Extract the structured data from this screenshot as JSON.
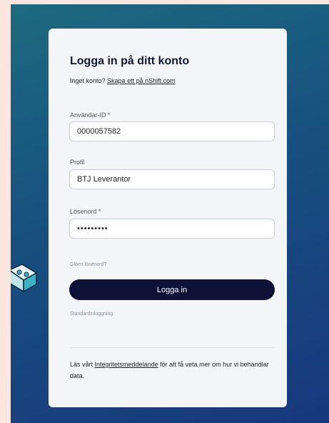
{
  "login": {
    "title": "Logga in på ditt konto",
    "no_account_text": "Inget konto? ",
    "create_link": "Skapa ett på nShift.com",
    "user_id_label": "Användar-ID *",
    "user_id_value": "0000057582",
    "profile_label": "Profil",
    "profile_value": "BTJ Leverantor",
    "password_label": "Lösenord *",
    "password_value": "password1",
    "forgot_link": "Glömt lösenord?",
    "login_button": "Logga in",
    "standard_login": "Standardinloggning",
    "privacy_prefix": "Läs vårt ",
    "privacy_link": "Integritetsmeddelande",
    "privacy_suffix": " för att få veta mer om hur vi behandlar data."
  },
  "colors": {
    "background_gradient_start": "#1d6a80",
    "background_gradient_end": "#18377e",
    "card": "#f3f5f8",
    "button": "#0e1236",
    "page_margin": "#fbe6df"
  }
}
